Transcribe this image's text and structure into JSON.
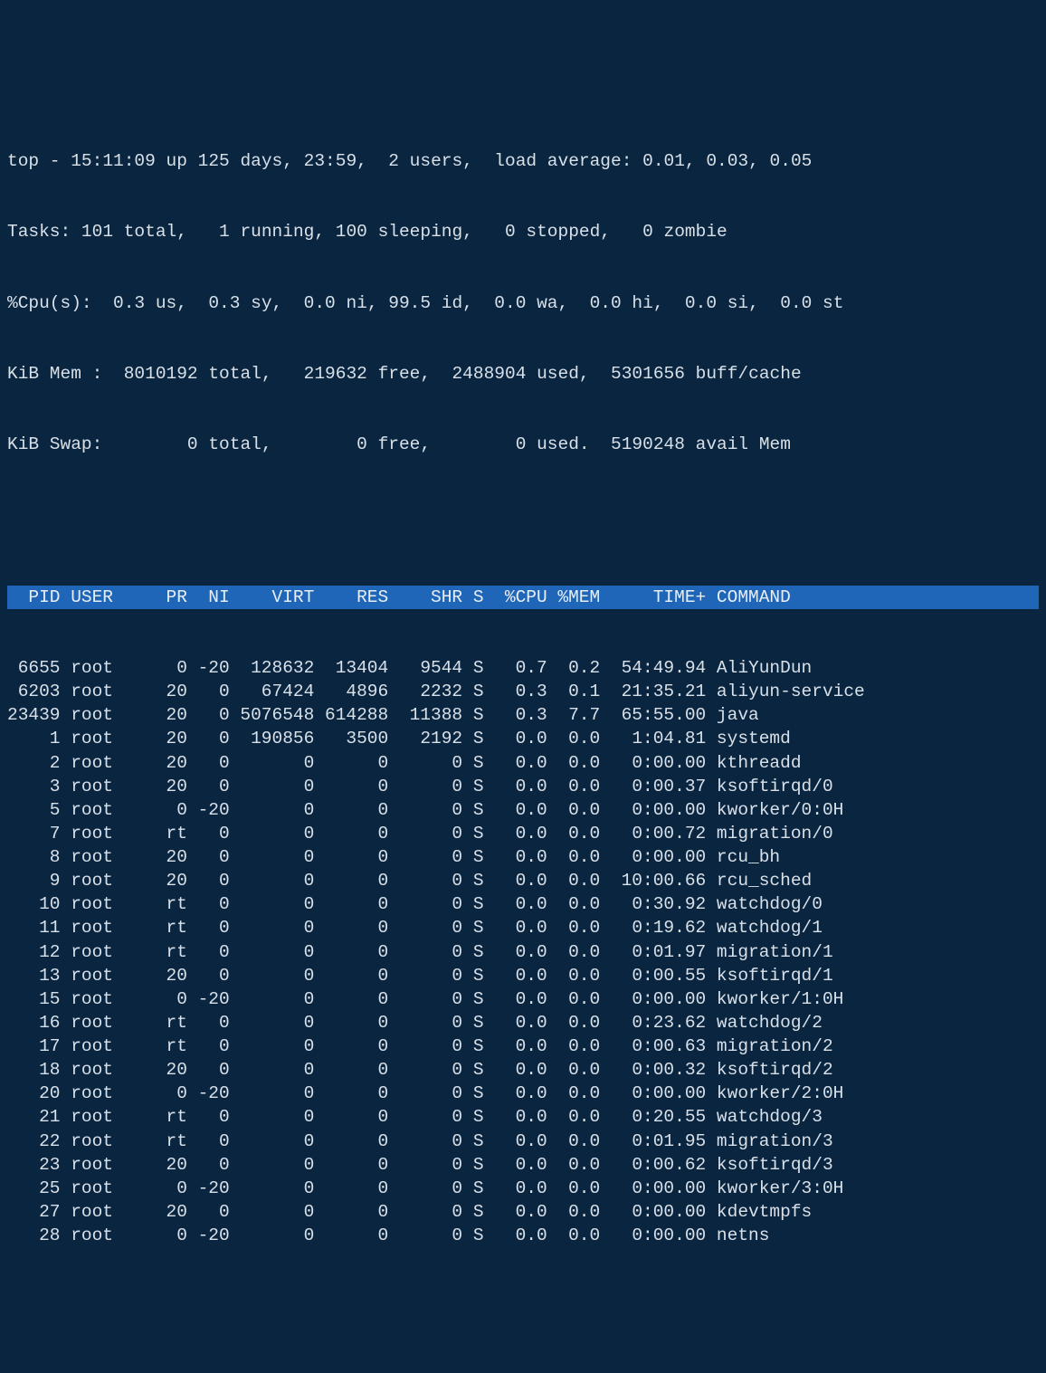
{
  "summary": {
    "line1": "top - 15:11:09 up 125 days, 23:59,  2 users,  load average: 0.01, 0.03, 0.05",
    "line2": "Tasks: 101 total,   1 running, 100 sleeping,   0 stopped,   0 zombie",
    "line3": "%Cpu(s):  0.3 us,  0.3 sy,  0.0 ni, 99.5 id,  0.0 wa,  0.0 hi,  0.0 si,  0.0 st",
    "line4": "KiB Mem :  8010192 total,   219632 free,  2488904 used,  5301656 buff/cache",
    "line5": "KiB Swap:        0 total,        0 free,        0 used.  5190248 avail Mem"
  },
  "columns": {
    "pid": "PID",
    "user": "USER",
    "pr": "PR",
    "ni": "NI",
    "virt": "VIRT",
    "res": "RES",
    "shr": "SHR",
    "s": "S",
    "cpu": "%CPU",
    "mem": "%MEM",
    "time": "TIME+",
    "cmd": "COMMAND"
  },
  "processes": [
    {
      "pid": "6655",
      "user": "root",
      "pr": "0",
      "ni": "-20",
      "virt": "128632",
      "res": "13404",
      "shr": "9544",
      "s": "S",
      "cpu": "0.7",
      "mem": "0.2",
      "time": "54:49.94",
      "cmd": "AliYunDun"
    },
    {
      "pid": "6203",
      "user": "root",
      "pr": "20",
      "ni": "0",
      "virt": "67424",
      "res": "4896",
      "shr": "2232",
      "s": "S",
      "cpu": "0.3",
      "mem": "0.1",
      "time": "21:35.21",
      "cmd": "aliyun-service"
    },
    {
      "pid": "23439",
      "user": "root",
      "pr": "20",
      "ni": "0",
      "virt": "5076548",
      "res": "614288",
      "shr": "11388",
      "s": "S",
      "cpu": "0.3",
      "mem": "7.7",
      "time": "65:55.00",
      "cmd": "java"
    },
    {
      "pid": "1",
      "user": "root",
      "pr": "20",
      "ni": "0",
      "virt": "190856",
      "res": "3500",
      "shr": "2192",
      "s": "S",
      "cpu": "0.0",
      "mem": "0.0",
      "time": "1:04.81",
      "cmd": "systemd"
    },
    {
      "pid": "2",
      "user": "root",
      "pr": "20",
      "ni": "0",
      "virt": "0",
      "res": "0",
      "shr": "0",
      "s": "S",
      "cpu": "0.0",
      "mem": "0.0",
      "time": "0:00.00",
      "cmd": "kthreadd"
    },
    {
      "pid": "3",
      "user": "root",
      "pr": "20",
      "ni": "0",
      "virt": "0",
      "res": "0",
      "shr": "0",
      "s": "S",
      "cpu": "0.0",
      "mem": "0.0",
      "time": "0:00.37",
      "cmd": "ksoftirqd/0"
    },
    {
      "pid": "5",
      "user": "root",
      "pr": "0",
      "ni": "-20",
      "virt": "0",
      "res": "0",
      "shr": "0",
      "s": "S",
      "cpu": "0.0",
      "mem": "0.0",
      "time": "0:00.00",
      "cmd": "kworker/0:0H"
    },
    {
      "pid": "7",
      "user": "root",
      "pr": "rt",
      "ni": "0",
      "virt": "0",
      "res": "0",
      "shr": "0",
      "s": "S",
      "cpu": "0.0",
      "mem": "0.0",
      "time": "0:00.72",
      "cmd": "migration/0"
    },
    {
      "pid": "8",
      "user": "root",
      "pr": "20",
      "ni": "0",
      "virt": "0",
      "res": "0",
      "shr": "0",
      "s": "S",
      "cpu": "0.0",
      "mem": "0.0",
      "time": "0:00.00",
      "cmd": "rcu_bh"
    },
    {
      "pid": "9",
      "user": "root",
      "pr": "20",
      "ni": "0",
      "virt": "0",
      "res": "0",
      "shr": "0",
      "s": "S",
      "cpu": "0.0",
      "mem": "0.0",
      "time": "10:00.66",
      "cmd": "rcu_sched"
    },
    {
      "pid": "10",
      "user": "root",
      "pr": "rt",
      "ni": "0",
      "virt": "0",
      "res": "0",
      "shr": "0",
      "s": "S",
      "cpu": "0.0",
      "mem": "0.0",
      "time": "0:30.92",
      "cmd": "watchdog/0"
    },
    {
      "pid": "11",
      "user": "root",
      "pr": "rt",
      "ni": "0",
      "virt": "0",
      "res": "0",
      "shr": "0",
      "s": "S",
      "cpu": "0.0",
      "mem": "0.0",
      "time": "0:19.62",
      "cmd": "watchdog/1"
    },
    {
      "pid": "12",
      "user": "root",
      "pr": "rt",
      "ni": "0",
      "virt": "0",
      "res": "0",
      "shr": "0",
      "s": "S",
      "cpu": "0.0",
      "mem": "0.0",
      "time": "0:01.97",
      "cmd": "migration/1"
    },
    {
      "pid": "13",
      "user": "root",
      "pr": "20",
      "ni": "0",
      "virt": "0",
      "res": "0",
      "shr": "0",
      "s": "S",
      "cpu": "0.0",
      "mem": "0.0",
      "time": "0:00.55",
      "cmd": "ksoftirqd/1"
    },
    {
      "pid": "15",
      "user": "root",
      "pr": "0",
      "ni": "-20",
      "virt": "0",
      "res": "0",
      "shr": "0",
      "s": "S",
      "cpu": "0.0",
      "mem": "0.0",
      "time": "0:00.00",
      "cmd": "kworker/1:0H"
    },
    {
      "pid": "16",
      "user": "root",
      "pr": "rt",
      "ni": "0",
      "virt": "0",
      "res": "0",
      "shr": "0",
      "s": "S",
      "cpu": "0.0",
      "mem": "0.0",
      "time": "0:23.62",
      "cmd": "watchdog/2"
    },
    {
      "pid": "17",
      "user": "root",
      "pr": "rt",
      "ni": "0",
      "virt": "0",
      "res": "0",
      "shr": "0",
      "s": "S",
      "cpu": "0.0",
      "mem": "0.0",
      "time": "0:00.63",
      "cmd": "migration/2"
    },
    {
      "pid": "18",
      "user": "root",
      "pr": "20",
      "ni": "0",
      "virt": "0",
      "res": "0",
      "shr": "0",
      "s": "S",
      "cpu": "0.0",
      "mem": "0.0",
      "time": "0:00.32",
      "cmd": "ksoftirqd/2"
    },
    {
      "pid": "20",
      "user": "root",
      "pr": "0",
      "ni": "-20",
      "virt": "0",
      "res": "0",
      "shr": "0",
      "s": "S",
      "cpu": "0.0",
      "mem": "0.0",
      "time": "0:00.00",
      "cmd": "kworker/2:0H"
    },
    {
      "pid": "21",
      "user": "root",
      "pr": "rt",
      "ni": "0",
      "virt": "0",
      "res": "0",
      "shr": "0",
      "s": "S",
      "cpu": "0.0",
      "mem": "0.0",
      "time": "0:20.55",
      "cmd": "watchdog/3"
    },
    {
      "pid": "22",
      "user": "root",
      "pr": "rt",
      "ni": "0",
      "virt": "0",
      "res": "0",
      "shr": "0",
      "s": "S",
      "cpu": "0.0",
      "mem": "0.0",
      "time": "0:01.95",
      "cmd": "migration/3"
    },
    {
      "pid": "23",
      "user": "root",
      "pr": "20",
      "ni": "0",
      "virt": "0",
      "res": "0",
      "shr": "0",
      "s": "S",
      "cpu": "0.0",
      "mem": "0.0",
      "time": "0:00.62",
      "cmd": "ksoftirqd/3"
    },
    {
      "pid": "25",
      "user": "root",
      "pr": "0",
      "ni": "-20",
      "virt": "0",
      "res": "0",
      "shr": "0",
      "s": "S",
      "cpu": "0.0",
      "mem": "0.0",
      "time": "0:00.00",
      "cmd": "kworker/3:0H"
    },
    {
      "pid": "27",
      "user": "root",
      "pr": "20",
      "ni": "0",
      "virt": "0",
      "res": "0",
      "shr": "0",
      "s": "S",
      "cpu": "0.0",
      "mem": "0.0",
      "time": "0:00.00",
      "cmd": "kdevtmpfs"
    },
    {
      "pid": "28",
      "user": "root",
      "pr": "0",
      "ni": "-20",
      "virt": "0",
      "res": "0",
      "shr": "0",
      "s": "S",
      "cpu": "0.0",
      "mem": "0.0",
      "time": "0:00.00",
      "cmd": "netns"
    }
  ]
}
